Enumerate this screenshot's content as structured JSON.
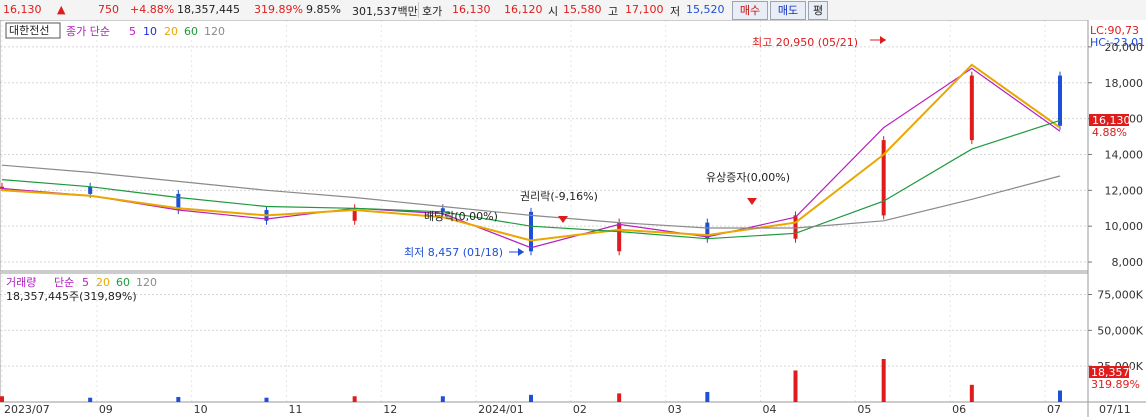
{
  "quote": {
    "price": "16,130",
    "change_arrow": "▲",
    "change": "750",
    "change_pct": "+4.88%",
    "volume": "18,357,445",
    "volume_ratio": "319.89%",
    "turnover": "9.85%",
    "trade_value": "301,537백만",
    "hoga_label": "호가",
    "hoga_sell": "16,130",
    "hoga_buy": "16,120",
    "open_label": "시",
    "open": "15,580",
    "high_label": "고",
    "high": "17,100",
    "low_label": "저",
    "low": "15,520",
    "buy_button": "매수",
    "sell_button": "매도",
    "eval_button": "평"
  },
  "colors": {
    "up": "#e01b1b",
    "down": "#1d4fd8",
    "ma5": "#b81ec0",
    "ma10": "#1e2ee0",
    "ma20": "#e8a800",
    "ma60": "#1e9a3c",
    "ma120": "#8a8a8a",
    "text_ma5": "#b01cc0"
  },
  "price_panel": {
    "stock_name": "대한전선",
    "legend_label": "종가 단순",
    "ma_periods": [
      "5",
      "10",
      "20",
      "60",
      "120"
    ],
    "lc": "LC:90,73",
    "hc": "HC:-23,01",
    "last_price_tag": "16,130",
    "last_pct_tag": "4.88%",
    "annotations": {
      "high": "최고 20,950 (05/21)",
      "low": "최저 8,457 (01/18)",
      "rights": "권리락(-9,16%)",
      "dividend": "배당락(0,00%)",
      "capital_increase": "유상증자(0,00%)"
    }
  },
  "volume_panel": {
    "legend_label": "거래량",
    "legend_type": "단순",
    "ma_periods": [
      "5",
      "20",
      "60",
      "120"
    ],
    "current": "18,357,445주(319,89%)",
    "last_volume_tag": "18,357K",
    "last_pct_tag": "319.89%"
  },
  "x_axis": {
    "labels": [
      "2023/07",
      "09",
      "10",
      "11",
      "12",
      "2024/01",
      "02",
      "03",
      "04",
      "05",
      "06",
      "07",
      "07/11"
    ]
  },
  "chart_data": [
    {
      "type": "line",
      "title": "대한전선",
      "x": [
        "2023-07",
        "2023-08",
        "2023-09",
        "2023-10",
        "2023-11",
        "2023-12",
        "2024-01",
        "2024-02",
        "2024-03",
        "2024-04",
        "2024-05",
        "2024-06",
        "2024-07"
      ],
      "series": [
        {
          "name": "종가",
          "values": [
            12200,
            11800,
            10900,
            10300,
            11000,
            10800,
            8600,
            10200,
            9300,
            10600,
            14800,
            18400,
            15600
          ]
        },
        {
          "name": "5",
          "values": [
            12100,
            11700,
            10900,
            10400,
            11000,
            10700,
            8800,
            10100,
            9400,
            10500,
            15500,
            18800,
            15300
          ]
        },
        {
          "name": "20",
          "values": [
            12000,
            11700,
            11000,
            10600,
            10900,
            10500,
            9200,
            9800,
            9500,
            10200,
            14000,
            19000,
            15500
          ]
        },
        {
          "name": "60",
          "values": [
            12600,
            12200,
            11600,
            11100,
            11000,
            10800,
            10000,
            9700,
            9300,
            9600,
            11400,
            14300,
            15900
          ]
        },
        {
          "name": "120",
          "values": [
            13400,
            13000,
            12500,
            12000,
            11600,
            11100,
            10600,
            10200,
            9900,
            9900,
            10300,
            11500,
            12800
          ]
        }
      ],
      "ylim": [
        7500,
        21500
      ],
      "y_ticks": [
        8000,
        10000,
        12000,
        14000,
        16000,
        18000,
        20000
      ],
      "y_tick_labels": [
        "8,000",
        "10,000",
        "12,000",
        "14,000",
        "16,000",
        "18,000",
        "20,000"
      ],
      "xlabel": "",
      "ylabel": ""
    },
    {
      "type": "bar",
      "title": "거래량",
      "x": [
        "2023-07",
        "2023-08",
        "2023-09",
        "2023-10",
        "2023-11",
        "2023-12",
        "2024-01",
        "2024-02",
        "2024-03",
        "2024-04",
        "2024-05",
        "2024-06",
        "2024-07"
      ],
      "series": [
        {
          "name": "거래량",
          "values": [
            4000000,
            3000000,
            3500000,
            3000000,
            4000000,
            4000000,
            5000000,
            6000000,
            7000000,
            22000000,
            30000000,
            12000000,
            8000000
          ]
        }
      ],
      "ylim": [
        0,
        90000000
      ],
      "y_ticks": [
        25000000,
        50000000,
        75000000
      ],
      "y_tick_labels": [
        "25,000K",
        "50,000K",
        "75,000K"
      ],
      "xlabel": "",
      "ylabel": ""
    }
  ]
}
